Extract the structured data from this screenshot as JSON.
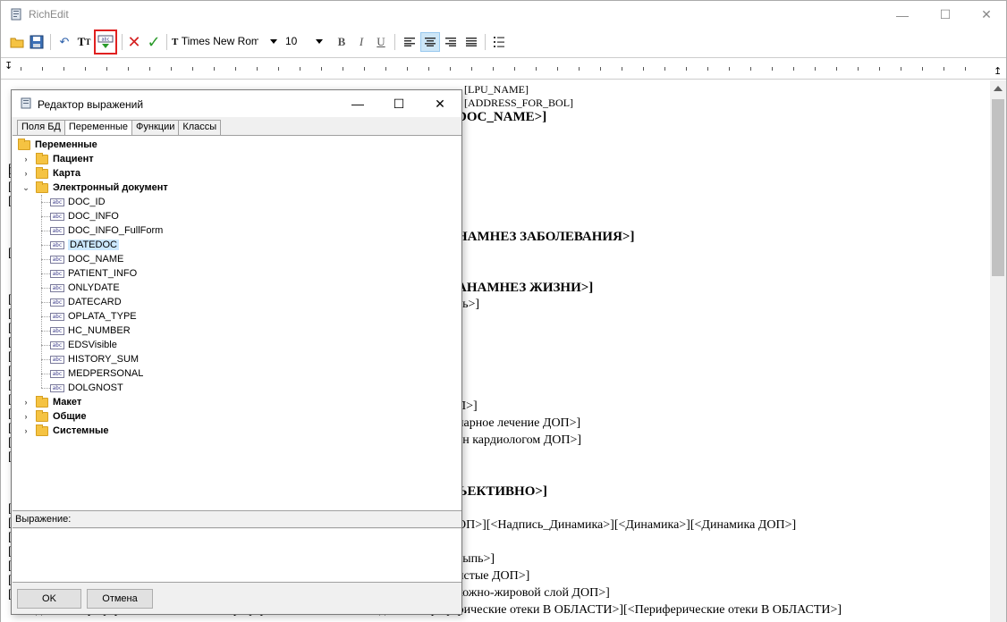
{
  "app": {
    "title": "RichEdit"
  },
  "toolbar": {
    "font_name": "Times New Roman",
    "font_size": "10"
  },
  "document": {
    "lines": [
      {
        "text": "[LPU_NAME]",
        "cls": "small"
      },
      {
        "text": "[ADDRESS_FOR_BOL]",
        "cls": "small"
      },
      {
        "text": "DOC_NAME>]",
        "cls": "bold"
      },
      {
        "text": "НАМНЕЗ ЗАБОЛЕВАНИЯ>]",
        "cls": "bold"
      },
      {
        "text": "АНАМНЕЗ ЖИЗНИ>]",
        "cls": "bold"
      },
      {
        "text": "ть>]",
        "cls": ""
      },
      {
        "text": "П>]",
        "cls": ""
      },
      {
        "text": "нарное лечение ДОП>]",
        "cls": ""
      },
      {
        "text": "ен кардиологом ДОП>]",
        "cls": ""
      },
      {
        "text": "ЪЕКТИВНО>]",
        "cls": "bold"
      },
      {
        "text": "ОП>][<Надпись_Динамика>][<Динамика>][<Динамика ДОП>]",
        "cls": ""
      },
      {
        "text": "сыпь>]",
        "cls": ""
      },
      {
        "text": "истые ДОП>]",
        "cls": ""
      },
      {
        "text": "кожно-жировой слой ДОП>]",
        "cls": ""
      },
      {
        "text": "[<Надпись_Периферические отеки>][<Периферические отеки>][<Надпись_Периферические отеки В ОБЛАСТИ>][<Периферические отеки В ОБЛАСТИ>]",
        "cls": ""
      }
    ]
  },
  "dialog": {
    "title": "Редактор выражений",
    "tabs": [
      "Поля БД",
      "Переменные",
      "Функции",
      "Классы"
    ],
    "tree": {
      "root": "Переменные",
      "groups": [
        "Пациент",
        "Карта",
        "Электронный документ",
        "Макет",
        "Общие",
        "Системные"
      ],
      "doc_items": [
        "DOC_ID",
        "DOC_INFO",
        "DOC_INFO_FullForm",
        "DATEDOC",
        "DOC_NAME",
        "PATIENT_INFO",
        "ONLYDATE",
        "DATECARD",
        "OPLATA_TYPE",
        "HC_NUMBER",
        "EDSVisible",
        "HISTORY_SUM",
        "MEDPERSONAL",
        "DOLGNOST"
      ],
      "selected": "DATEDOC",
      "var_icon_text": "abc"
    },
    "expression_label": "Выражение:",
    "expression_value": "",
    "ok_label": "OK",
    "cancel_label": "Отмена"
  }
}
